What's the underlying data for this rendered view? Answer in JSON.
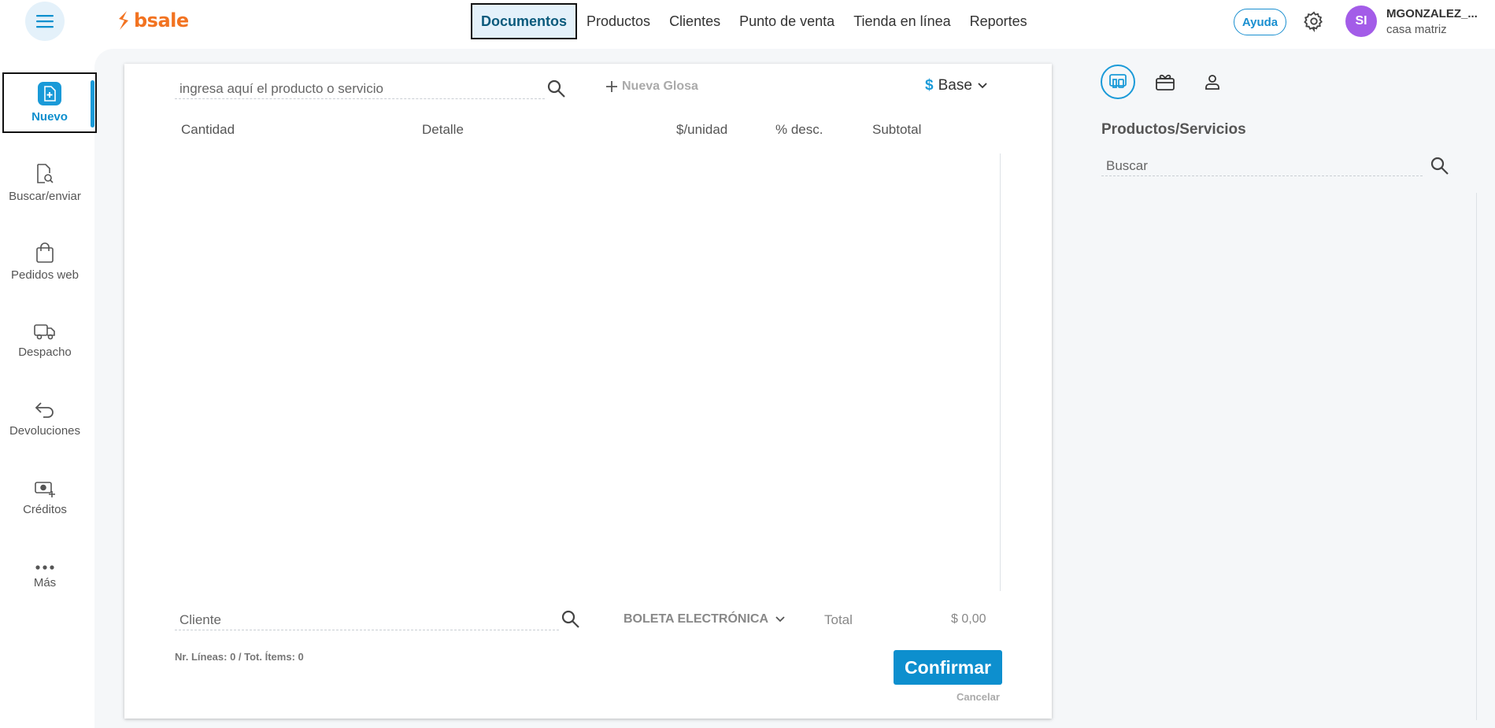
{
  "topbar": {
    "logo": "bsale",
    "nav": [
      "Documentos",
      "Productos",
      "Clientes",
      "Punto de venta",
      "Tienda en línea",
      "Reportes"
    ],
    "active_nav": "Documentos",
    "help_label": "Ayuda",
    "avatar_initials": "SI",
    "user_name": "MGONZALEZ_...",
    "user_branch": "casa matriz"
  },
  "sidebar": {
    "items": [
      {
        "label": "Nuevo",
        "icon": "new-document-icon",
        "active": true
      },
      {
        "label": "Buscar/enviar",
        "icon": "document-search-icon"
      },
      {
        "label": "Pedidos web",
        "icon": "shopping-bag-icon"
      },
      {
        "label": "Despacho",
        "icon": "truck-icon"
      },
      {
        "label": "Devoluciones",
        "icon": "return-arrow-icon"
      },
      {
        "label": "Créditos",
        "icon": "cash-plus-icon"
      },
      {
        "label": "Más",
        "icon": "more-dots-icon"
      }
    ]
  },
  "document": {
    "product_search_placeholder": "ingresa aquí el producto o servicio",
    "new_gloss_label": "Nueva Glosa",
    "price_list": "Base",
    "columns": [
      "Cantidad",
      "Detalle",
      "$/unidad",
      "% desc.",
      "Subtotal"
    ],
    "client_placeholder": "Cliente",
    "document_type": "BOLETA ELECTRÓNICA",
    "total_label": "Total",
    "total_value": "$ 0,00",
    "lines_summary": "Nr. Líneas: 0 / Tot. Ítems: 0",
    "confirm_label": "Confirmar",
    "cancel_label": "Cancelar"
  },
  "right_panel": {
    "tabs": [
      "products-devices-icon",
      "gift-card-icon",
      "user-icon"
    ],
    "title": "Productos/Servicios",
    "search_placeholder": "Buscar"
  },
  "colors": {
    "brand_orange": "#f27321",
    "accent_blue": "#0d8fce",
    "avatar_purple": "#a35ce8"
  }
}
